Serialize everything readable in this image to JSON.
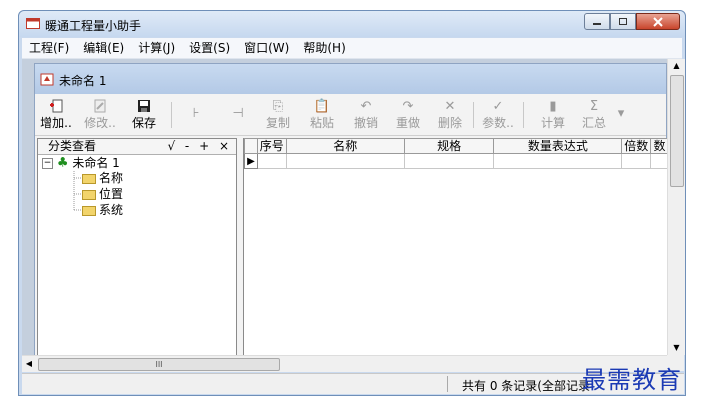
{
  "app": {
    "title": "暖通工程量小助手"
  },
  "menu": [
    "工程(F)",
    "编辑(E)",
    "计算(J)",
    "设置(S)",
    "窗口(W)",
    "帮助(H)"
  ],
  "doc": {
    "title": "未命名 1"
  },
  "toolbar": {
    "add": "增加..",
    "modify": "修改..",
    "save": "保存",
    "copy": "复制",
    "paste": "粘贴",
    "undo": "撤销",
    "redo": "重做",
    "delete": "删除",
    "params": "参数..",
    "calc": "计算",
    "total": "汇总"
  },
  "tree": {
    "header": "分类查看",
    "header_controls": "√ - + ×",
    "root": "未命名 1",
    "children": [
      "名称",
      "位置",
      "系统"
    ]
  },
  "grid": {
    "columns": [
      "序号",
      "名称",
      "规格",
      "数量表达式",
      "倍数",
      "数"
    ]
  },
  "scroll": {
    "thumb": "III"
  },
  "status": {
    "text": "共有 0 条记录(全部记录"
  },
  "watermark": "最需教育"
}
